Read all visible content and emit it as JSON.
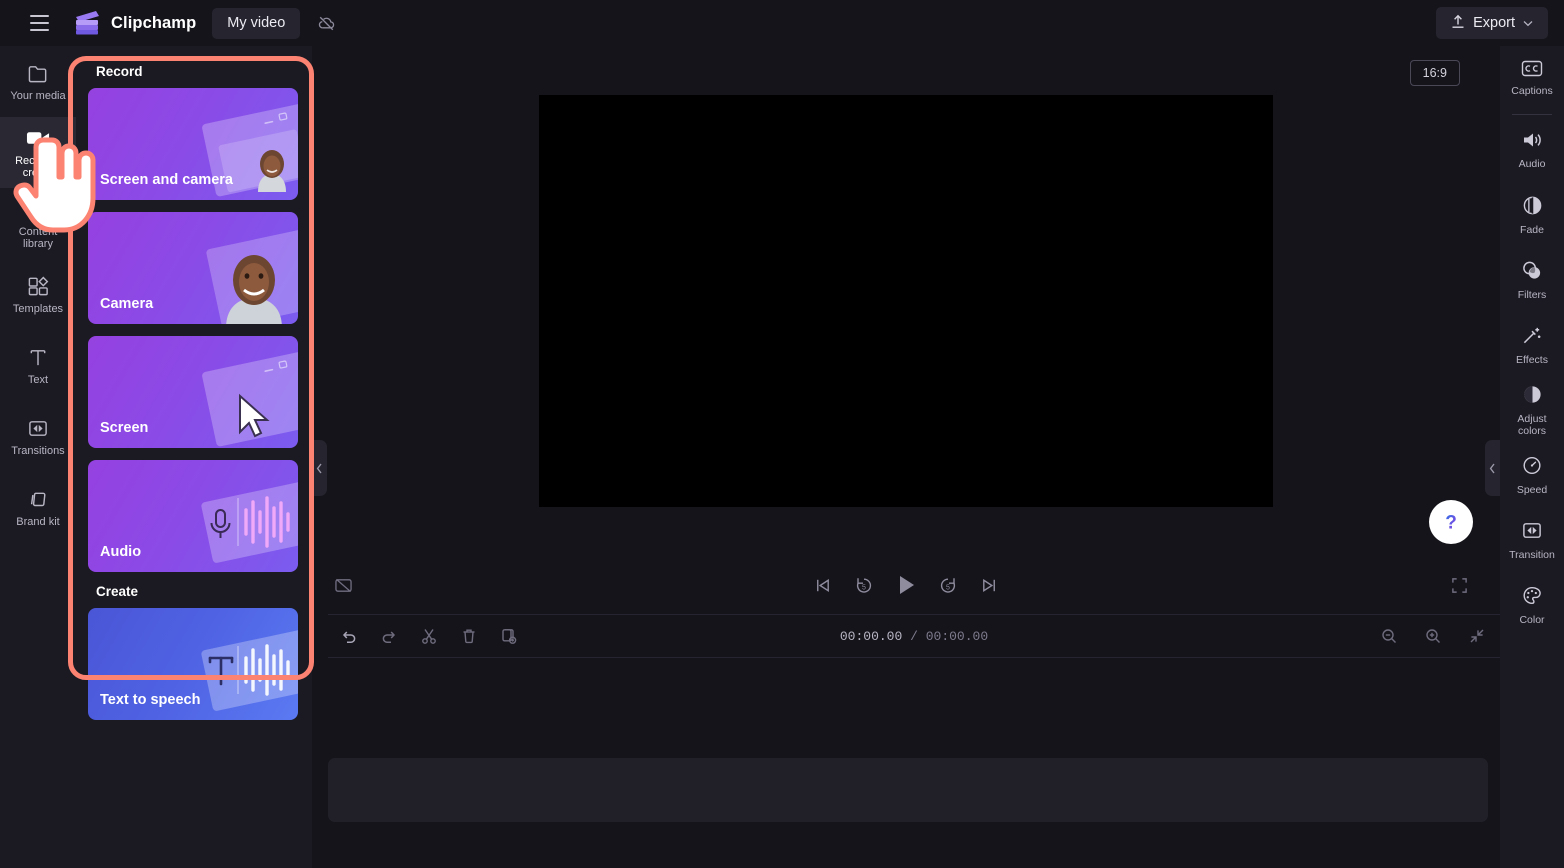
{
  "app": {
    "brand_name": "Clipchamp",
    "project_title": "My video",
    "logo_colors": {
      "light": "#a87ff0",
      "mid": "#8b6be8",
      "dark": "#6f5ae0"
    }
  },
  "header": {
    "menu_icon": "hamburger-icon",
    "logo_icon": "clipchamp-logo-icon",
    "cloud_icon": "cloud-off-icon",
    "export_label": "Export",
    "export_icon": "upload-icon",
    "export_chevron_icon": "chevron-down-icon"
  },
  "left_rail": {
    "items": [
      {
        "label": "Your media",
        "icon": "folder-icon",
        "active": false
      },
      {
        "label": "Record & create",
        "icon": "video-camera-icon",
        "active": true
      },
      {
        "label": "Content library",
        "icon": "library-icon",
        "active": false
      },
      {
        "label": "Templates",
        "icon": "templates-icon",
        "active": false
      },
      {
        "label": "Text",
        "icon": "text-t-icon",
        "active": false
      },
      {
        "label": "Transitions",
        "icon": "transitions-icon",
        "active": false
      },
      {
        "label": "Brand kit",
        "icon": "brand-kit-icon",
        "active": false
      }
    ]
  },
  "record_panel": {
    "highlight_color": "#fc8372",
    "sections": [
      {
        "title": "Record",
        "cards": [
          {
            "label": "Screen and camera",
            "style": "purple",
            "art": "screen-with-person-art"
          },
          {
            "label": "Camera",
            "style": "purple",
            "art": "person-portrait-art"
          },
          {
            "label": "Screen",
            "style": "purple",
            "art": "screen-with-pointer-art"
          },
          {
            "label": "Audio",
            "style": "purple",
            "art": "microphone-waveform-art"
          }
        ]
      },
      {
        "title": "Create",
        "cards": [
          {
            "label": "Text to speech",
            "style": "blue",
            "art": "text-waveform-art"
          }
        ]
      }
    ]
  },
  "center": {
    "aspect_ratio": "16:9",
    "player": {
      "captions_toggle_icon": "captions-off-icon",
      "skip_start_icon": "skip-to-start-icon",
      "rewind_icon": "rewind-5s-icon",
      "play_icon": "play-icon",
      "forward_icon": "forward-5s-icon",
      "skip_end_icon": "skip-to-end-icon",
      "fullscreen_icon": "fullscreen-icon"
    },
    "timeline_toolbar": {
      "undo_icon": "undo-icon",
      "redo_icon": "redo-icon",
      "split_icon": "split-scissors-icon",
      "delete_icon": "trash-icon",
      "duplicate_icon": "duplicate-icon",
      "current_time": "00:00.00",
      "time_separator": "/",
      "total_time": "00:00.00",
      "zoom_out_icon": "zoom-out-icon",
      "zoom_in_icon": "zoom-in-icon",
      "fit_icon": "fit-to-screen-icon"
    }
  },
  "right_rail": {
    "items": [
      {
        "label": "Captions",
        "icon": "captions-cc-icon"
      },
      {
        "label": "Audio",
        "icon": "speaker-icon"
      },
      {
        "label": "Fade",
        "icon": "fade-icon"
      },
      {
        "label": "Filters",
        "icon": "filters-icon"
      },
      {
        "label": "Effects",
        "icon": "effects-wand-icon"
      },
      {
        "label": "Adjust colors",
        "icon": "adjust-colors-icon"
      },
      {
        "label": "Speed",
        "icon": "speedometer-icon"
      },
      {
        "label": "Transition",
        "icon": "transition-icon"
      },
      {
        "label": "Color",
        "icon": "color-palette-icon"
      }
    ]
  },
  "collapse": {
    "left_icon": "chevron-left-icon",
    "right_icon": "chevron-left-icon"
  },
  "help": {
    "icon": "question-mark-icon",
    "glyph": "?"
  }
}
